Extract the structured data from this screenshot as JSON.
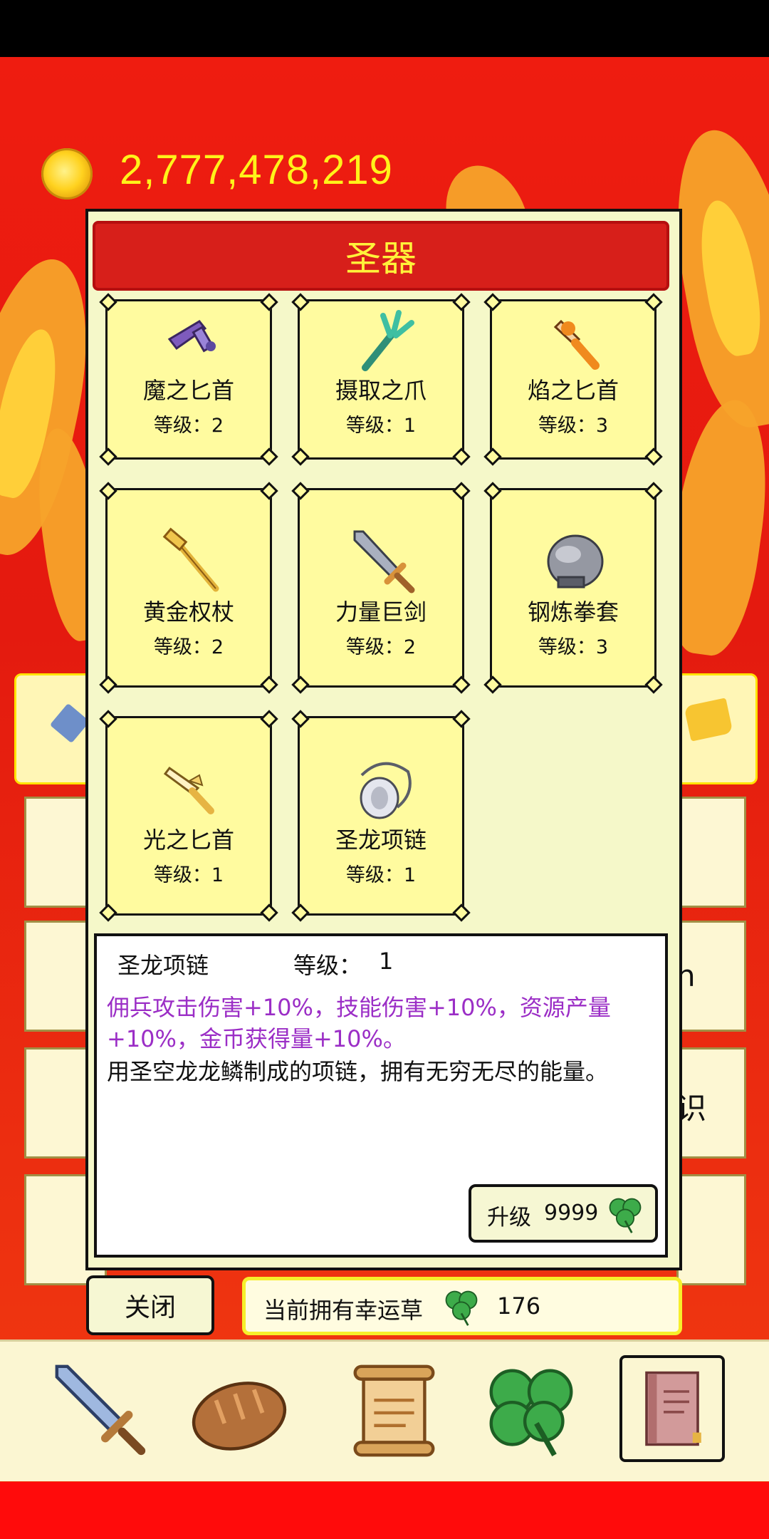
{
  "header": {
    "coin_icon": "gold-coin-icon",
    "coin_value": "2,777,478,219"
  },
  "background_panels": {
    "right_label_1": "h",
    "right_label_2": "识"
  },
  "dialog": {
    "title": "圣器",
    "items": [
      {
        "name": "魔之匕首",
        "level": "等级：2",
        "icon": "dagger-icon",
        "color": "#7e5bbd"
      },
      {
        "name": "摄取之爪",
        "level": "等级：1",
        "icon": "claw-icon",
        "color": "#3fbfa2"
      },
      {
        "name": "焰之匕首",
        "level": "等级：3",
        "icon": "fire-dagger-icon",
        "color": "#f08a1e"
      },
      {
        "name": "黄金权杖",
        "level": "等级：2",
        "icon": "golden-scepter-icon",
        "color": "#e3b33a"
      },
      {
        "name": "力量巨剑",
        "level": "等级：2",
        "icon": "greatsword-icon",
        "color": "#8b95a8"
      },
      {
        "name": "钢炼拳套",
        "level": "等级：3",
        "icon": "gauntlet-icon",
        "color": "#8d8f98"
      },
      {
        "name": "光之匕首",
        "level": "等级：1",
        "icon": "light-dagger-icon",
        "color": "#f5d26a"
      },
      {
        "name": "圣龙项链",
        "level": "等级：1",
        "icon": "necklace-icon",
        "color": "#c7c9d6"
      }
    ],
    "detail": {
      "name": "圣龙项链",
      "level_label": "等级：",
      "level_value": "1",
      "effect": "佣兵攻击伤害+10%，技能伤害+10%，资源产量+10%，金币获得量+10%。",
      "description": "用圣空龙龙鳞制成的项链，拥有无穷无尽的能量。",
      "upgrade_label": "升级",
      "upgrade_cost": "9999",
      "upgrade_icon": "clover-icon"
    },
    "close_label": "关闭",
    "clover_owned_label": "当前拥有幸运草",
    "clover_owned_count": "176"
  },
  "nav": {
    "items": [
      {
        "icon": "sword-icon"
      },
      {
        "icon": "bread-icon"
      },
      {
        "icon": "scroll-icon"
      },
      {
        "icon": "clover-icon"
      },
      {
        "icon": "book-icon",
        "selected": true
      }
    ]
  },
  "colors": {
    "background_red": "#e21a10",
    "title_bar": "#d71f1a",
    "title_text": "#fff23a",
    "card_bg": "#fffb9f",
    "effect_text": "#9b2ec6",
    "coin_text": "#fff21a"
  }
}
